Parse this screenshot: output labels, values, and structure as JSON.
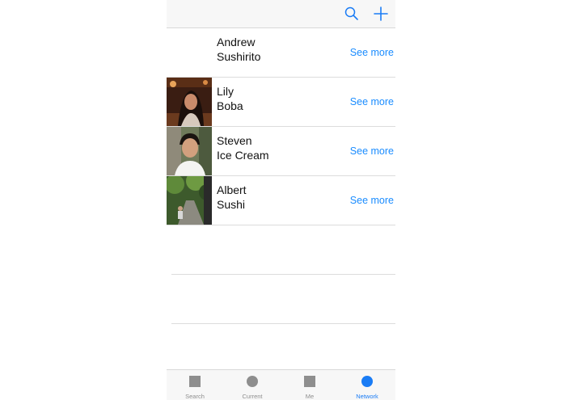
{
  "navbar": {
    "search_icon": "search-icon",
    "add_icon": "plus-icon",
    "accent": "#1a7cf5"
  },
  "contacts": [
    {
      "name": "Andrew",
      "food": "Sushirito",
      "link": "See more",
      "photo": "none"
    },
    {
      "name": "Lily",
      "food": "Boba",
      "link": "See more",
      "photo": "portrait-woman-restaurant"
    },
    {
      "name": "Steven",
      "food": "Ice Cream",
      "link": "See more",
      "photo": "portrait-man-outdoor"
    },
    {
      "name": "Albert",
      "food": "Sushi",
      "link": "See more",
      "photo": "person-forest-path"
    }
  ],
  "tabbar": {
    "tabs": [
      {
        "label": "Search",
        "icon": "square-icon",
        "active": false
      },
      {
        "label": "Current",
        "icon": "circle-icon",
        "active": false
      },
      {
        "label": "Me",
        "icon": "square-icon",
        "active": false
      },
      {
        "label": "Network",
        "icon": "circle-icon",
        "active": true
      }
    ],
    "active_color": "#1a7cf5",
    "inactive_color": "#8e8e8e"
  }
}
